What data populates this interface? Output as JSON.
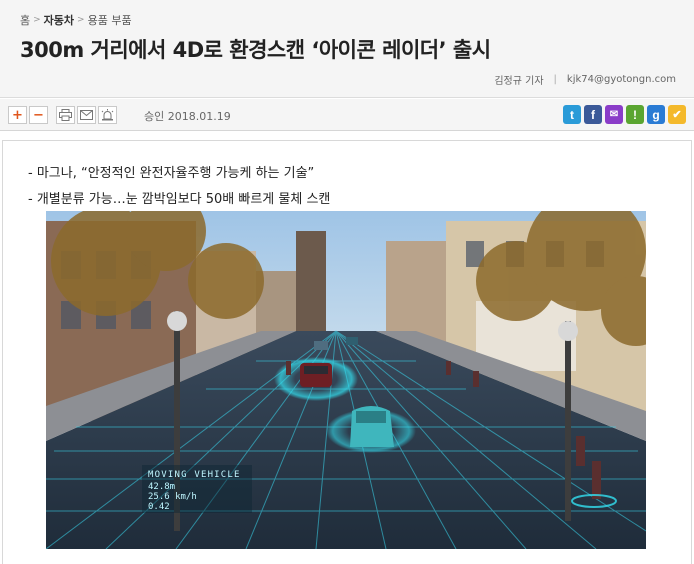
{
  "breadcrumb": {
    "home": "홈",
    "category": "자동차",
    "subcategory": "용품 부품"
  },
  "article": {
    "title": "300m 거리에서 4D로 환경스캔 ‘아이콘 레이더’ 출시",
    "reporter": "김정규 기자",
    "email": "kjk74@gyotongn.com",
    "approved": "승인 2018.01.19",
    "subheadings": [
      "- 마그나, “안정적인 완전자율주행 가능케 하는 기술”",
      "- 개별분류 가능…눈 깜박임보다 50배 빠르게 물체 스캔"
    ]
  },
  "toolbar": {
    "font_increase_label": "+",
    "font_decrease_label": "−",
    "print_icon": "printer-icon",
    "email_icon": "envelope-icon",
    "report_icon": "siren-icon"
  },
  "social": [
    {
      "name": "twitter",
      "glyph": "t",
      "color": "#2a9bd8"
    },
    {
      "name": "facebook",
      "glyph": "f",
      "color": "#3b5998"
    },
    {
      "name": "naver-talk",
      "glyph": "✉",
      "color": "#8a3cc8"
    },
    {
      "name": "band",
      "glyph": "!",
      "color": "#5aa531"
    },
    {
      "name": "google-plus",
      "glyph": "g",
      "color": "#2a7bd4"
    },
    {
      "name": "bookmark",
      "glyph": "✔",
      "color": "#f4b92b"
    }
  ],
  "photo": {
    "overlay_title": "MOVING VEHICLE",
    "overlay_value": "42.8m",
    "overlay_line2": "25.6 km/h",
    "overlay_line3": "0.42"
  },
  "colors": {
    "accent": "#e0561c",
    "scan": "#33e0f0"
  }
}
